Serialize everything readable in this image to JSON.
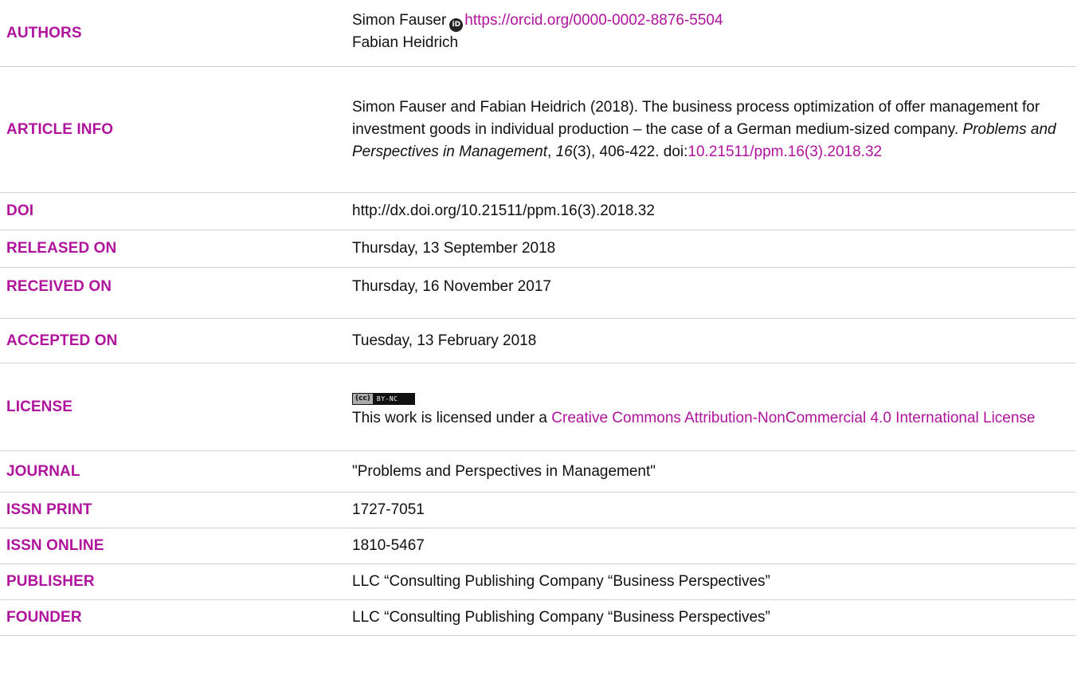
{
  "authors": {
    "label": "AUTHORS",
    "author1_name": "Simon Fauser",
    "author1_orcid_url": "https://orcid.org/0000-0002-8876-5504",
    "author2_name": "Fabian Heidrich",
    "orcid_icon_glyph": "iD"
  },
  "article_info": {
    "label": "ARTICLE INFO",
    "citation_prefix": "Simon Fauser and Fabian Heidrich (2018). The business process optimization of offer management for investment goods in individual production – the case of a German medium-sized company. ",
    "journal_italic": "Problems and Perspectives in Management",
    "comma1": ", ",
    "volume_italic": "16",
    "issue_pages": "(3), 406-422. doi:",
    "doi_link": "10.21511/ppm.16(3).2018.32"
  },
  "doi": {
    "label": "DOI",
    "value": "http://dx.doi.org/10.21511/ppm.16(3).2018.32"
  },
  "released_on": {
    "label": "RELEASED ON",
    "value": "Thursday, 13 September 2018"
  },
  "received_on": {
    "label": "RECEIVED ON",
    "value": "Thursday, 16 November 2017"
  },
  "accepted_on": {
    "label": "ACCEPTED ON",
    "value": "Tuesday, 13 February 2018"
  },
  "license": {
    "label": "LICENSE",
    "badge_cc": "(cc)",
    "badge_terms": "BY-NC",
    "text_prefix": "This work is licensed under a ",
    "link_text": "Creative Commons Attribution-NonCommercial 4.0 International License"
  },
  "journal": {
    "label": "JOURNAL",
    "value": "\"Problems and Perspectives in Management\""
  },
  "issn_print": {
    "label": "ISSN PRINT",
    "value": "1727-7051"
  },
  "issn_online": {
    "label": "ISSN ONLINE",
    "value": "1810-5467"
  },
  "publisher": {
    "label": "PUBLISHER",
    "value": "LLC “Consulting Publishing Company “Business Perspectives”"
  },
  "founder": {
    "label": "FOUNDER",
    "value": "LLC “Consulting Publishing Company “Business Perspectives”"
  },
  "colors": {
    "accent": "#b0139c",
    "text": "#111111",
    "divider": "#cfcfcf"
  }
}
